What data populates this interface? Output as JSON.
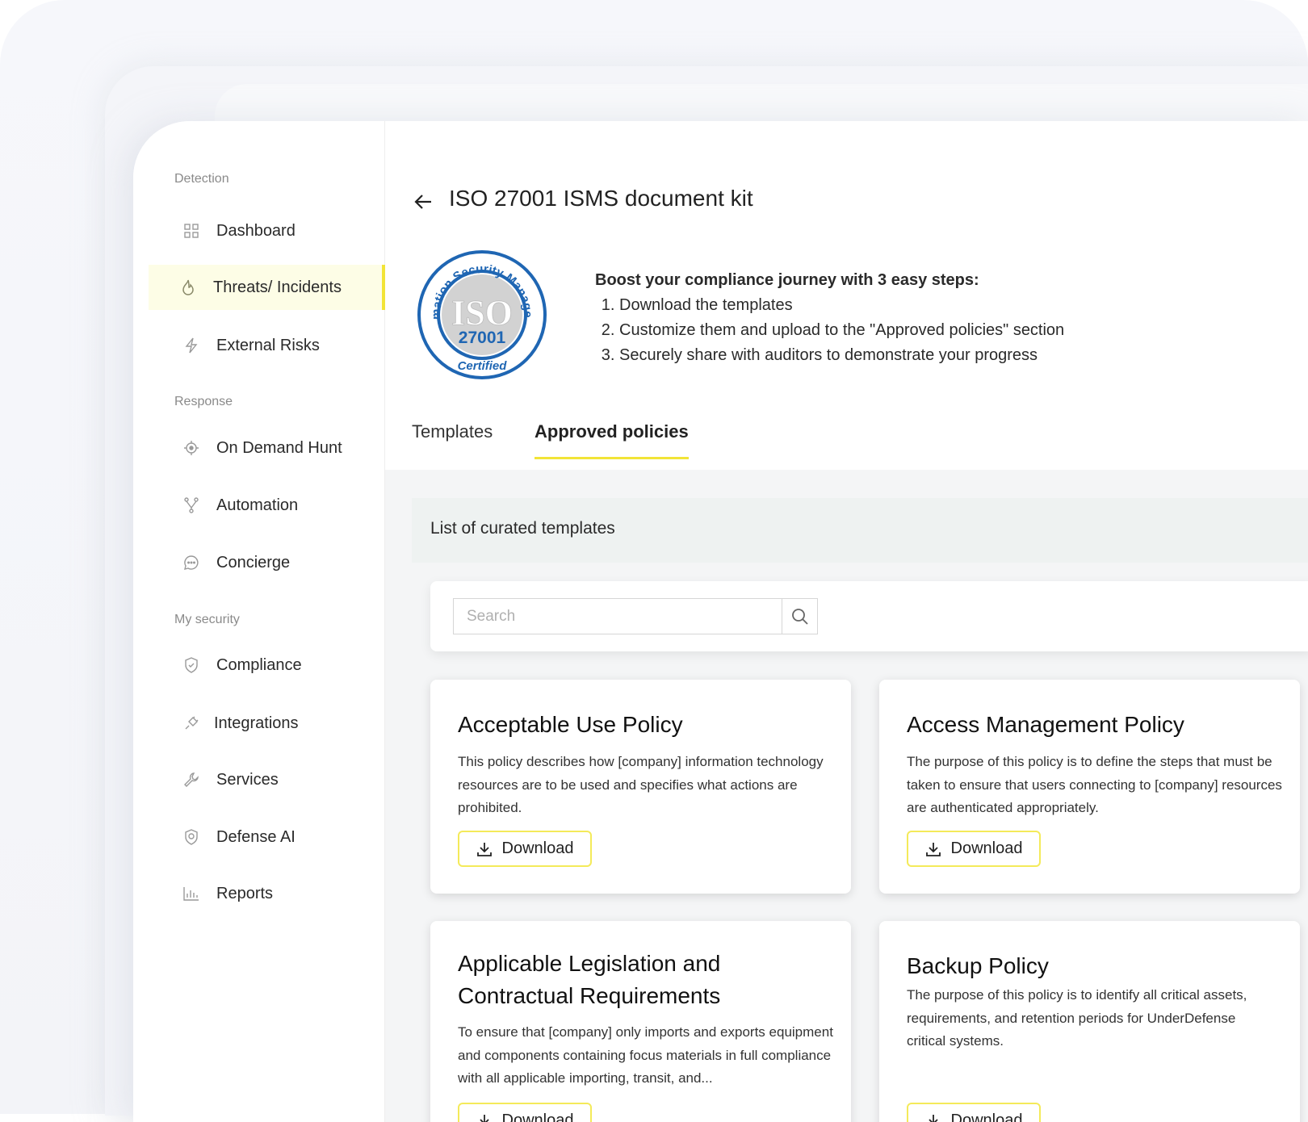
{
  "sidebar": {
    "sections": [
      {
        "label": "Detection",
        "items": [
          {
            "label": "Dashboard",
            "icon": "grid-icon"
          },
          {
            "label": "Threats/ Incidents",
            "icon": "flame-icon",
            "active": true
          },
          {
            "label": "External Risks",
            "icon": "lightning-icon"
          }
        ]
      },
      {
        "label": "Response",
        "items": [
          {
            "label": "On Demand Hunt",
            "icon": "crosshair-icon"
          },
          {
            "label": "Automation",
            "icon": "branch-icon"
          },
          {
            "label": "Concierge",
            "icon": "chat-icon"
          }
        ]
      },
      {
        "label": "My security",
        "items": [
          {
            "label": "Compliance",
            "icon": "shield-check-icon"
          },
          {
            "label": "Integrations",
            "icon": "plug-icon"
          },
          {
            "label": "Services",
            "icon": "wrench-icon"
          },
          {
            "label": "Defense AI",
            "icon": "shield-ai-icon"
          },
          {
            "label": "Reports",
            "icon": "bar-chart-icon"
          }
        ]
      }
    ]
  },
  "header": {
    "title": "ISO 27001 ISMS document kit"
  },
  "logo": {
    "top_text": "Information Security Management",
    "center": "ISO",
    "number": "27001",
    "bottom": "Certified"
  },
  "intro": {
    "heading": "Boost your compliance journey with 3 easy steps:",
    "steps": [
      "Download the templates",
      "Customize them and upload to the \"Approved policies\" section",
      "Securely share with auditors to demonstrate your progress"
    ]
  },
  "tabs": [
    {
      "label": "Templates"
    },
    {
      "label": "Approved policies",
      "active": true
    }
  ],
  "list": {
    "title": "List of curated templates",
    "search_placeholder": "Search",
    "search_value": ""
  },
  "cards": [
    {
      "title": "Acceptable Use Policy",
      "description": "This policy describes how [company] information technology resources are to be used and specifies what actions are prohibited.",
      "button": "Download"
    },
    {
      "title": "Access Management Policy",
      "description": "The purpose of this policy is to define the steps that must be taken to ensure that users connecting to [company] resources are authenticated appropriately.",
      "button": "Download"
    },
    {
      "title": "Applicable Legislation and Contractual Requirements",
      "description": "To ensure that [company] only imports and exports equipment and components containing focus materials in full compliance with all applicable importing, transit, and...",
      "button": "Download"
    },
    {
      "title": "Backup Policy",
      "description": "The purpose of this policy is to identify all critical assets, requirements, and retention periods for UnderDefense critical systems.",
      "button": "Download"
    }
  ],
  "colors": {
    "accent": "#f2e437",
    "active_bg": "#fdfde6",
    "logo_blue": "#1f66b3",
    "content_bg": "#f4f5f6"
  }
}
